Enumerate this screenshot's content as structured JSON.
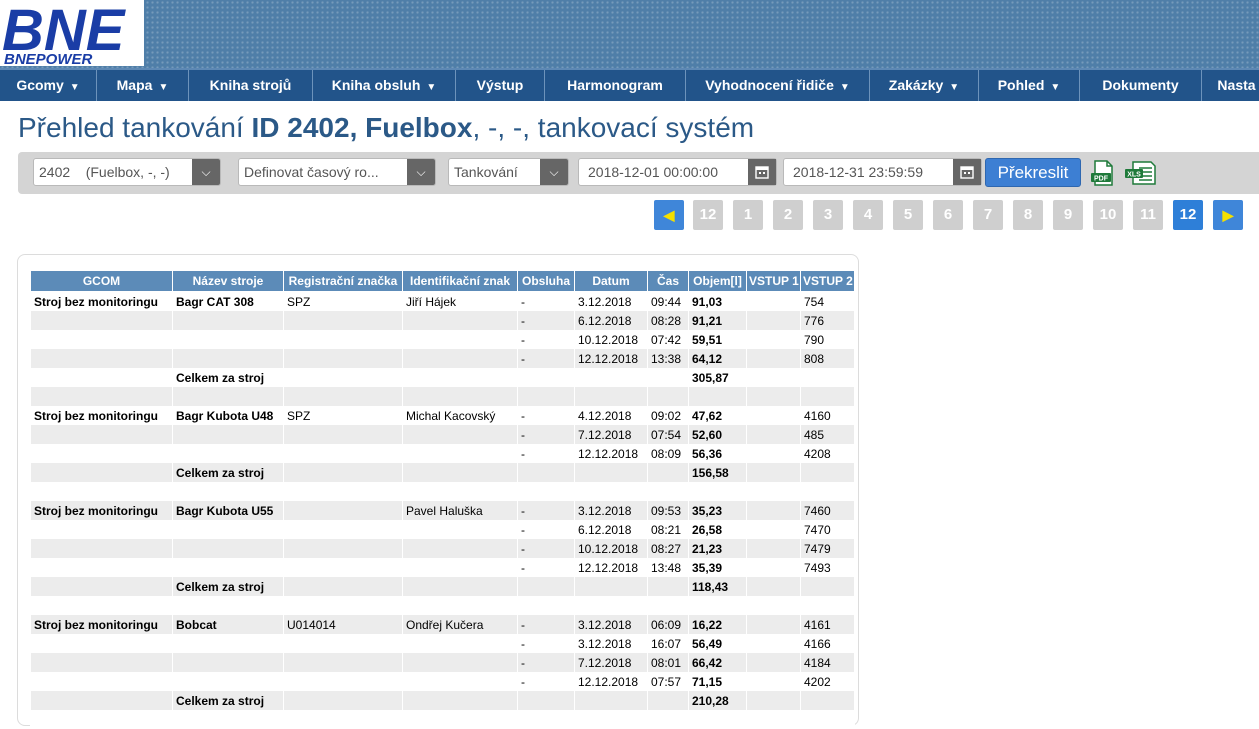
{
  "logo": {
    "text": "BNE",
    "subtext": "BNEPOWER"
  },
  "nav": [
    {
      "label": "Gcomy",
      "dropdown": true
    },
    {
      "label": "Mapa",
      "dropdown": true
    },
    {
      "label": "Kniha strojů",
      "dropdown": false
    },
    {
      "label": "Kniha obsluh",
      "dropdown": true
    },
    {
      "label": "Výstup",
      "dropdown": false
    },
    {
      "label": "Harmonogram",
      "dropdown": false
    },
    {
      "label": "Vyhodnocení řidiče",
      "dropdown": true
    },
    {
      "label": "Zakázky",
      "dropdown": true
    },
    {
      "label": "Pohled",
      "dropdown": true
    },
    {
      "label": "Dokumenty",
      "dropdown": false
    },
    {
      "label": "Nasta",
      "dropdown": false
    }
  ],
  "title": {
    "prefix": "Přehled tankování ",
    "bold": "ID 2402, Fuelbox",
    "suffix": ", -, -, tankovací systém"
  },
  "filters": {
    "unit_select": "2402    (Fuelbox, -, -)",
    "range_select": "Definovat časový ro...",
    "type_select": "Tankování",
    "date_from": "2018-12-01 00:00:00",
    "date_to": "2018-12-31 23:59:59",
    "redraw_label": "Překreslit",
    "pdf_label": "PDF",
    "xls_label": "XLS"
  },
  "pagination": {
    "first": "12",
    "pages": [
      "1",
      "2",
      "3",
      "4",
      "5",
      "6",
      "7",
      "8",
      "9",
      "10",
      "11",
      "12"
    ],
    "active": "12"
  },
  "table": {
    "headers": [
      "GCOM",
      "Název stroje",
      "Registrační značka",
      "Identifikační znak",
      "Obsluha",
      "Datum",
      "Čas",
      "Objem[l]",
      "VSTUP 1",
      "VSTUP 2"
    ],
    "rows": [
      [
        "Stroj bez monitoringu",
        "Bagr CAT 308",
        "SPZ",
        "Jiří Hájek",
        "-",
        "3.12.2018",
        "09:44",
        "91,03",
        "",
        "754"
      ],
      [
        "",
        "",
        "",
        "",
        "-",
        "6.12.2018",
        "08:28",
        "91,21",
        "",
        "776"
      ],
      [
        "",
        "",
        "",
        "",
        "-",
        "10.12.2018",
        "07:42",
        "59,51",
        "",
        "790"
      ],
      [
        "",
        "",
        "",
        "",
        "-",
        "12.12.2018",
        "13:38",
        "64,12",
        "",
        "808"
      ],
      [
        "",
        "Celkem za stroj",
        "",
        "",
        "",
        "",
        "",
        "305,87",
        "",
        ""
      ],
      [
        "",
        "",
        "",
        "",
        "",
        "",
        "",
        "",
        "",
        ""
      ],
      [
        "Stroj bez monitoringu",
        "Bagr Kubota U48",
        "SPZ",
        "Michal Kacovský",
        "-",
        "4.12.2018",
        "09:02",
        "47,62",
        "",
        "4160"
      ],
      [
        "",
        "",
        "",
        "",
        "-",
        "7.12.2018",
        "07:54",
        "52,60",
        "",
        "485"
      ],
      [
        "",
        "",
        "",
        "",
        "-",
        "12.12.2018",
        "08:09",
        "56,36",
        "",
        "4208"
      ],
      [
        "",
        "Celkem za stroj",
        "",
        "",
        "",
        "",
        "",
        "156,58",
        "",
        ""
      ],
      [
        "",
        "",
        "",
        "",
        "",
        "",
        "",
        "",
        "",
        ""
      ],
      [
        "Stroj bez monitoringu",
        "Bagr Kubota U55",
        "",
        "Pavel Haluška",
        "-",
        "3.12.2018",
        "09:53",
        "35,23",
        "",
        "7460"
      ],
      [
        "",
        "",
        "",
        "",
        "-",
        "6.12.2018",
        "08:21",
        "26,58",
        "",
        "7470"
      ],
      [
        "",
        "",
        "",
        "",
        "-",
        "10.12.2018",
        "08:27",
        "21,23",
        "",
        "7479"
      ],
      [
        "",
        "",
        "",
        "",
        "-",
        "12.12.2018",
        "13:48",
        "35,39",
        "",
        "7493"
      ],
      [
        "",
        "Celkem za stroj",
        "",
        "",
        "",
        "",
        "",
        "118,43",
        "",
        ""
      ],
      [
        "",
        "",
        "",
        "",
        "",
        "",
        "",
        "",
        "",
        ""
      ],
      [
        "Stroj bez monitoringu",
        "Bobcat",
        "U014014",
        "Ondřej Kučera",
        "-",
        "3.12.2018",
        "06:09",
        "16,22",
        "",
        "4161"
      ],
      [
        "",
        "",
        "",
        "",
        "-",
        "3.12.2018",
        "16:07",
        "56,49",
        "",
        "4166"
      ],
      [
        "",
        "",
        "",
        "",
        "-",
        "7.12.2018",
        "08:01",
        "66,42",
        "",
        "4184"
      ],
      [
        "",
        "",
        "",
        "",
        "-",
        "12.12.2018",
        "07:57",
        "71,15",
        "",
        "4202"
      ],
      [
        "",
        "Celkem za stroj",
        "",
        "",
        "",
        "",
        "",
        "210,28",
        "",
        ""
      ],
      [
        "",
        "",
        "",
        "",
        "",
        "",
        "",
        "",
        "",
        ""
      ]
    ]
  },
  "colors": {
    "nav_bg": "#22548a",
    "header_bg": "#4f7ea8",
    "title": "#2b5987",
    "th_bg": "#5c8bb8",
    "active_page": "#2e7fd8",
    "button": "#3d7fd3"
  }
}
